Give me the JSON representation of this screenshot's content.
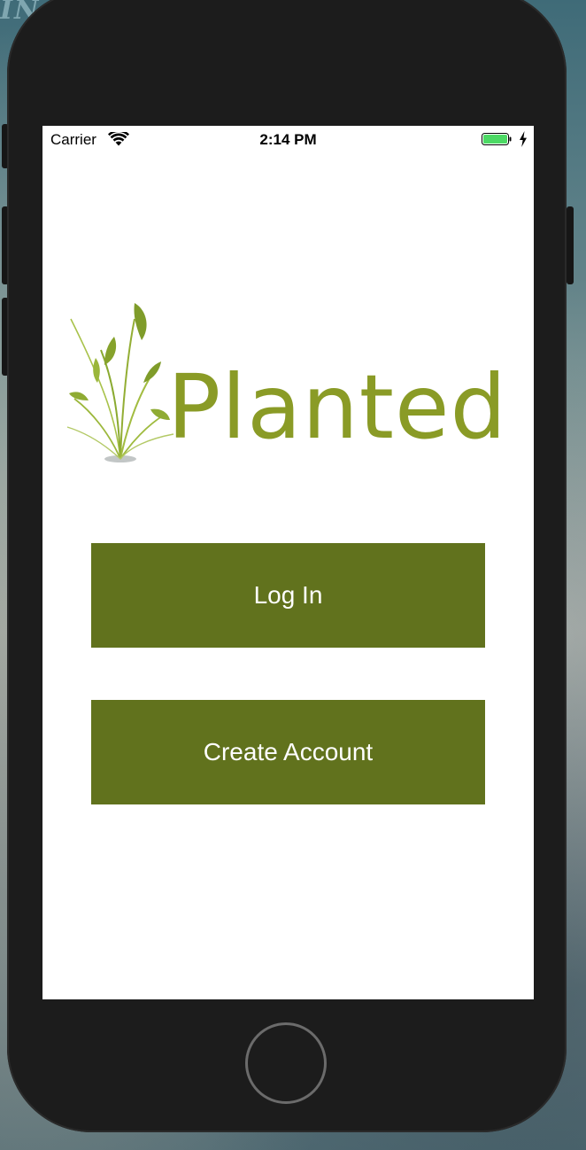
{
  "background": {
    "corner_text": "IN"
  },
  "status_bar": {
    "carrier": "Carrier",
    "time": "2:14 PM",
    "battery_icon": "battery-full-icon",
    "wifi_icon": "wifi-icon",
    "charging_icon": "charging-bolt-icon"
  },
  "logo": {
    "text": "Planted",
    "icon": "plant-sprout-icon"
  },
  "buttons": {
    "login_label": "Log In",
    "create_account_label": "Create Account"
  },
  "colors": {
    "button_bg": "#61721d",
    "logo_green": "#8a9b26",
    "battery_green": "#4cd964"
  }
}
